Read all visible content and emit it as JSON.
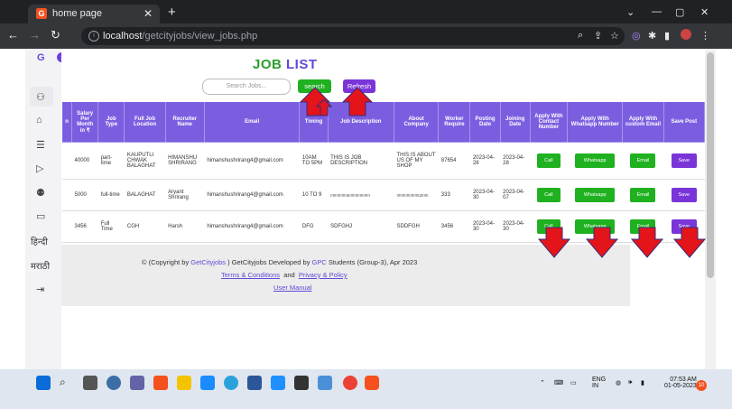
{
  "browser": {
    "tab_title": "home page",
    "url_host": "localhost",
    "url_path": "/getcityjobs/view_jobs.php",
    "new_tab": "+"
  },
  "page": {
    "title_a": "JOB ",
    "title_b": "LIST",
    "search_placeholder": "Search Jobs...",
    "search_btn": "search",
    "refresh_btn": "Refresh"
  },
  "sidebar": {
    "logo": "G",
    "hindi": "हिन्दी",
    "marathi": "मराठी"
  },
  "table": {
    "headers": [
      "n",
      "Salary Per Month in ₹",
      "Job Type",
      "Full Job Location",
      "Recruiter Name",
      "Email",
      "Timing",
      "Job Description",
      "About Company",
      "Worker Require",
      "Posting Date",
      "Joining Date",
      "Apply With Contact Number",
      "Apply With Whatsapp Number",
      "Apply With custom Email",
      "Save Post"
    ],
    "rows": [
      {
        "salary": "40000",
        "type": "part-time",
        "location": "KAUPUTLI CHWAK BALAGHAT",
        "recruiter": "HIMANSHU SHRIRANG",
        "email": "himanshushrirang4@gmail.com",
        "timing": "10AM TO 5PM",
        "desc": "THIS IS JOB DESCRIPTION",
        "about": "THIS IS ABOUT US OF MY SHOP",
        "workers": "87654",
        "posting": "2023-04-28",
        "joining": "2023-04-28"
      },
      {
        "salary": "5000",
        "type": "full-time",
        "location": "BALAGHAT",
        "recruiter": "Aryant Shrirang",
        "email": "himanshushrirang4@gmail.com",
        "timing": "10 TO 9",
        "desc": "!!!!!!!!!!!!!!4!!!!!!!!!!!!!!!!!!!",
        "about": "!!!!!!!!!!!!!!!!!!!!2!!!!!!",
        "workers": "333",
        "posting": "2023-04-30",
        "joining": "2023-04-07"
      },
      {
        "salary": "3456",
        "type": "Full Time",
        "location": "CGH",
        "recruiter": "Harsh",
        "email": "himanshushrirang4@gmail.com",
        "timing": "DFG",
        "desc": "SDFGHJ",
        "about": "SDDFGH",
        "workers": "3456",
        "posting": "2023-04-30",
        "joining": "2023-04-30"
      }
    ],
    "btn_call": "Call",
    "btn_whatsapp": "Whatsapp",
    "btn_email": "Email",
    "btn_save": "Save"
  },
  "footer": {
    "copy_a": "© (Copyright by ",
    "brand": "GetCityjobs",
    "copy_b": " ) GetCityjobs Developed by ",
    "gpc": "GPC",
    "copy_c": " Students (Group-3), Apr 2023",
    "terms": "Terms & Conditions",
    "and": "and",
    "privacy": "Privacy & Policy",
    "manual": "User Manual"
  },
  "taskbar": {
    "lang1": "ENG",
    "lang2": "IN",
    "time": "07:53 AM",
    "date": "01-05-2023",
    "badge": "10"
  },
  "colors": {
    "accent_purple": "#7b5ee0",
    "green": "#1fb11f",
    "arrow_red": "#e3141a"
  }
}
